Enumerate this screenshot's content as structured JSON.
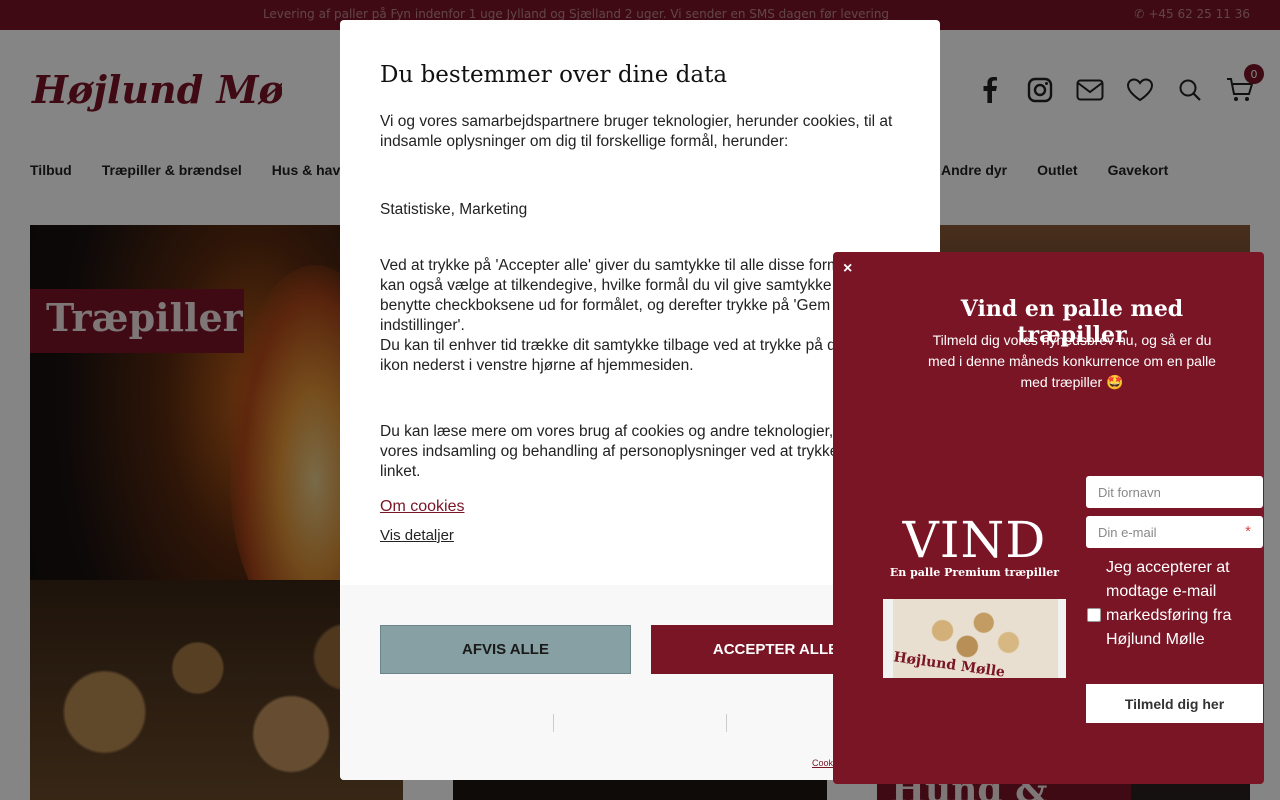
{
  "topbar": {
    "message": "Levering af paller på Fyn indenfor 1 uge Jylland og Sjælland 2 uger. Vi sender en SMS dagen før levering",
    "phone": "+45 62 25 11 36"
  },
  "header": {
    "logo_text": "Højlund Mølle",
    "cart_count": "0"
  },
  "nav": {
    "left": [
      "Tilbud",
      "Træpiller & brændsel",
      "Hus & have"
    ],
    "right": [
      "Andre dyr",
      "Outlet",
      "Gavekort"
    ]
  },
  "cards": {
    "card1_label": "Træpiller",
    "card3_label": "Hund & Kat"
  },
  "cookie_modal": {
    "title": "Du bestemmer over dine data",
    "intro": "Vi og vores samarbejdspartnere bruger teknologier, herunder cookies, til at indsamle oplysninger om dig til forskellige formål, herunder:",
    "purposes": "Statistiske, Marketing",
    "consent": "Ved at trykke på 'Accepter alle' giver du samtykke til alle disse formål. Du kan også vælge at tilkendegive, hvilke formål du vil give samtykke til ved at benytte checkboksene ud for formålet, og derefter trykke på 'Gem indstillinger'.",
    "withdraw": "Du kan til enhver tid trække dit samtykke tilbage ved at trykke på det lille ikon nederst i venstre hjørne af hjemmesiden.",
    "more_info": "Du kan læse mere om vores brug af cookies og andre teknologier, samt om vores indsamling og behandling af personoplysninger ved at trykke på linket.",
    "about_cookies": "Om cookies",
    "show_details": "Vis detaljer",
    "reject_label": "AFVIS ALLE",
    "accept_label": "ACCEPTER ALLE",
    "cookiebot_text": "Cookiebot"
  },
  "newsletter": {
    "close": "×",
    "title": "Vind en palle med træpiller",
    "description": "Tilmeld dig vores nyhedsbrev nu, og så er du med i denne måneds konkurrence om en palle med træpiller 🤩",
    "promo_big": "VIND",
    "promo_sub": "En palle Premium træpiller",
    "promo_brand": "Højlund Mølle",
    "firstname_placeholder": "Dit fornavn",
    "email_placeholder": "Din e-mail",
    "required_mark": "*",
    "consent_label": "Jeg accepterer at modtage e-mail markedsføring fra Højlund Mølle",
    "submit_label": "Tilmeld dig her"
  },
  "colors": {
    "brand": "#7a1526",
    "reject_button": "#86a0a3",
    "overlay": "rgba(0,0,0,0.48)"
  },
  "icons": [
    "phone-icon",
    "facebook-icon",
    "instagram-icon",
    "mail-icon",
    "heart-icon",
    "search-icon",
    "cart-icon",
    "close-icon"
  ]
}
